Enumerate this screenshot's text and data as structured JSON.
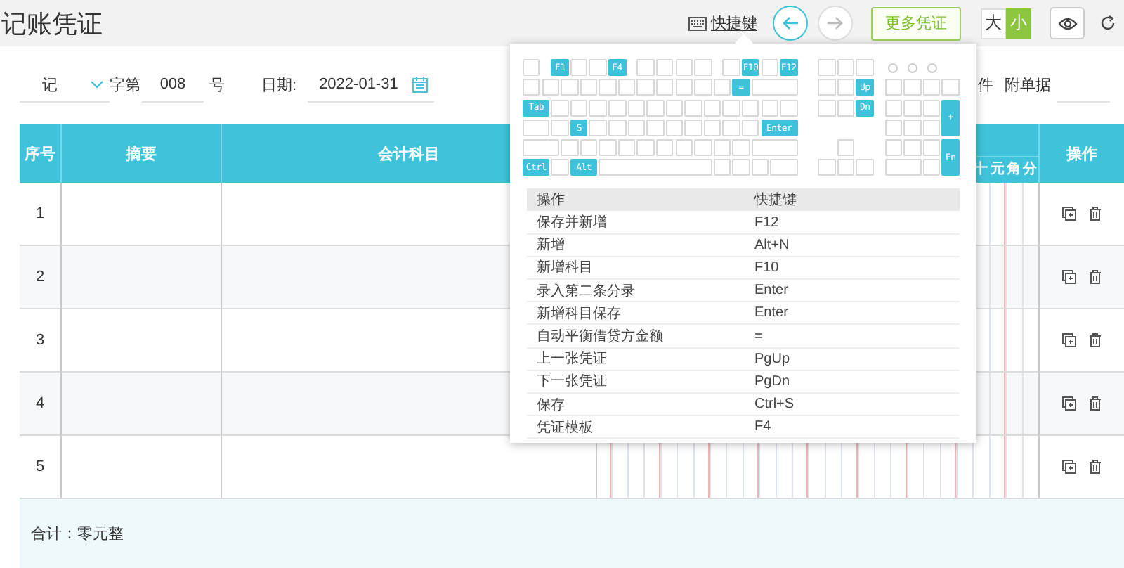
{
  "header": {
    "title": "记账凭证",
    "shortcut_link": "快捷键",
    "nav_buttons": [
      {
        "kind": "back",
        "disabled": false
      },
      {
        "kind": "forward",
        "disabled": true
      }
    ],
    "more_vouchers_button": "更多凭证",
    "size_toggle": [
      {
        "label": "大",
        "selected": false
      },
      {
        "label": "小",
        "selected": true
      }
    ]
  },
  "voucher_form": {
    "type_select": "记",
    "prefix_label": "字第",
    "number": "008",
    "number_suffix": "号",
    "date_label": "日期:",
    "date": "2022-01-31",
    "attachment_tail": "件",
    "attachments_label": "附单据"
  },
  "entries_table": {
    "columns": [
      "序号",
      "摘要",
      "会计科目"
    ],
    "money_digits": [
      "十",
      "元",
      "角",
      "分"
    ],
    "actions_column": "操作",
    "rows": [
      {
        "index": "1"
      },
      {
        "index": "2"
      },
      {
        "index": "3"
      },
      {
        "index": "4"
      },
      {
        "index": "5"
      }
    ],
    "total": "合计：零元整"
  },
  "shortcut_popup": {
    "keyboard_keys": [
      "F1",
      "F4",
      "F10",
      "F12",
      "=",
      "Up",
      "Tab",
      "Dn",
      "+",
      "S",
      "Enter",
      "En",
      "Ctrl",
      "Alt"
    ],
    "columns": [
      "操作",
      "快捷键"
    ],
    "rows": [
      {
        "action": "保存并新增",
        "keys": "F12"
      },
      {
        "action": "新增",
        "keys": "Alt+N"
      },
      {
        "action": "新增科目",
        "keys": "F10"
      },
      {
        "action": "录入第二条分录",
        "keys": "Enter"
      },
      {
        "action": "新增科目保存",
        "keys": "Enter"
      },
      {
        "action": "自动平衡借贷方金额",
        "keys": "="
      },
      {
        "action": "上一张凭证",
        "keys": "PgUp"
      },
      {
        "action": "下一张凭证",
        "keys": "PgDn"
      },
      {
        "action": "保存",
        "keys": "Ctrl+S"
      },
      {
        "action": "凭证模板",
        "keys": "F4"
      }
    ]
  }
}
